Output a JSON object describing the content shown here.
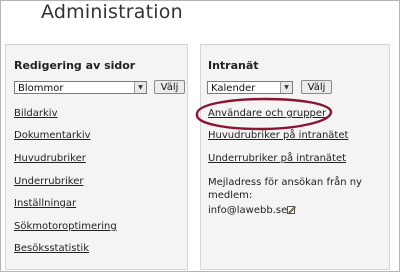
{
  "page": {
    "title": "Administration"
  },
  "left_panel": {
    "heading": "Redigering av sidor",
    "select": {
      "value": "Blommor"
    },
    "go_button": "Välj",
    "links": [
      "Bildarkiv",
      "Dokumentarkiv",
      "Huvudrubriker",
      "Underrubriker",
      "Inställningar",
      "Sökmotoroptimering",
      "Besöksstatistik"
    ]
  },
  "right_panel": {
    "heading": "Intranät",
    "select": {
      "value": "Kalender"
    },
    "go_button": "Välj",
    "links": [
      "Användare och grupper",
      "Huvudrubriker på intranätet",
      "Underrubriker på intranätet"
    ],
    "email_label_line1": "Mejladress för ansökan från ny",
    "email_label_line2": "medlem:",
    "email_value": "info@lawebb.se"
  },
  "colors": {
    "highlight": "#8a1530",
    "panel_bg": "#f4f4f4"
  },
  "icons": {
    "edit": "edit-pencil-icon",
    "dropdown": "chevron-down-icon"
  }
}
